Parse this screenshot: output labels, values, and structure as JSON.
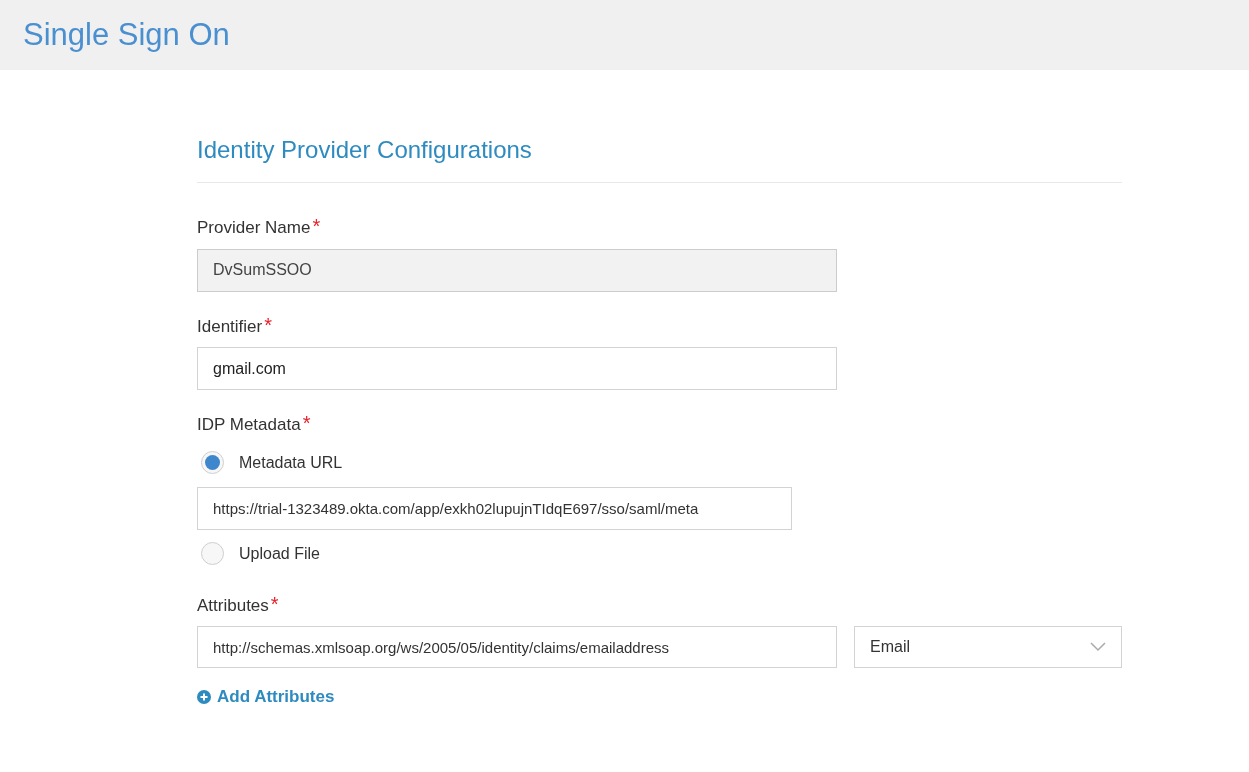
{
  "header": {
    "title": "Single Sign On"
  },
  "section": {
    "title": "Identity Provider Configurations"
  },
  "fields": [
    {
      "kind": "text",
      "label": "Provider Name",
      "required_mark": "*",
      "value": "DvSumSSOO",
      "disabled": true
    },
    {
      "kind": "text",
      "label": "Identifier",
      "required_mark": "*",
      "value": "gmail.com",
      "disabled": false
    },
    {
      "kind": "radio",
      "label": "IDP Metadata",
      "required_mark": "*",
      "options": [
        {
          "label": "Metadata URL",
          "selected": true,
          "value": "https://trial-1323489.okta.com/app/exkh02lupujnTIdqE697/sso/saml/meta"
        },
        {
          "label": "Upload File",
          "selected": false
        }
      ]
    },
    {
      "kind": "attributes",
      "label": "Attributes",
      "required_mark": "*",
      "rows": [
        {
          "claim": "http://schemas.xmlsoap.org/ws/2005/05/identity/claims/emailaddress",
          "mapping": "Email"
        }
      ],
      "add_link": "Add Attributes"
    }
  ]
}
